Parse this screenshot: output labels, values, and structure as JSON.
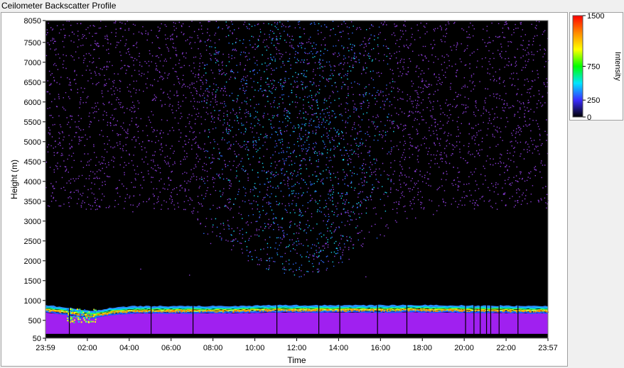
{
  "window": {
    "title": "Ceilometer Backscatter Profile"
  },
  "chart_data": {
    "type": "heatmap",
    "title": "",
    "xlabel": "Time",
    "ylabel": "Height (m)",
    "x_ticks": [
      "23:59",
      "02:00",
      "04:00",
      "06:00",
      "08:00",
      "10:00",
      "12:00",
      "14:00",
      "16:00",
      "18:00",
      "20:00",
      "22:00",
      "23:57"
    ],
    "y_ticks": [
      50,
      500,
      1000,
      1500,
      2000,
      2500,
      3000,
      3500,
      4000,
      4500,
      5000,
      5500,
      6000,
      6500,
      7000,
      7500,
      8050
    ],
    "ylim": [
      50,
      8050
    ],
    "xlim_hours": [
      -0.017,
      23.95
    ],
    "grid": false,
    "colorbar": {
      "label": "Intensity",
      "ticks": [
        0,
        250,
        750,
        1500
      ],
      "range": [
        0,
        1500
      ],
      "colors": [
        "#000000",
        "#3a2cff",
        "#00e5ff",
        "#00ff00",
        "#ffff00",
        "#ff8800",
        "#ff0000"
      ]
    },
    "features": {
      "boundary_layer_top_m": [
        880,
        820,
        730,
        830,
        860,
        860,
        860,
        860,
        860,
        870,
        880,
        880,
        880,
        880,
        880,
        880,
        890,
        880,
        880,
        870,
        870,
        860,
        860
      ],
      "strong_layer_base_m": 620,
      "strong_layer_color": "#a020f0",
      "aerosol_scatter_zone_m": [
        1600,
        8050
      ],
      "vertical_gaps_hours": [
        1.1,
        5.0,
        7.0,
        11.0,
        13.0,
        14.0,
        15.8,
        17.2,
        20.0,
        20.4,
        20.7,
        21.0,
        21.2,
        21.6,
        22.5
      ]
    }
  }
}
